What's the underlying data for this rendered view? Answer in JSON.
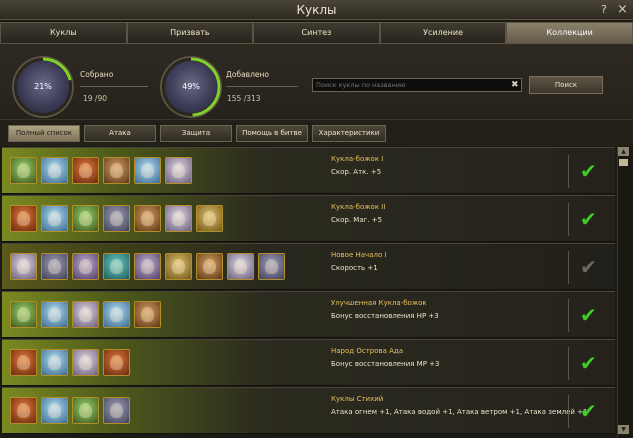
{
  "window": {
    "title": "Куклы",
    "help": "?",
    "close": "×"
  },
  "tabs": [
    {
      "label": "Куклы",
      "active": false
    },
    {
      "label": "Призвать",
      "active": false
    },
    {
      "label": "Синтез",
      "active": false
    },
    {
      "label": "Усиление",
      "active": false
    },
    {
      "label": "Коллекции",
      "active": true
    }
  ],
  "summary": {
    "collected": {
      "percent_text": "21%",
      "label": "Собрано",
      "value": "19 /90",
      "fraction": 0.21
    },
    "added": {
      "percent_text": "49%",
      "label": "Добавлено",
      "value": "155 /313",
      "fraction": 0.49
    }
  },
  "search": {
    "placeholder": "Поиск куклы по названию",
    "clear_icon": "clear-icon",
    "button_label": "Поиск"
  },
  "filters": [
    {
      "label": "Полный список",
      "active": true
    },
    {
      "label": "Атака",
      "active": false
    },
    {
      "label": "Защита",
      "active": false
    },
    {
      "label": "Помощь в битве",
      "active": false
    },
    {
      "label": "Характеристики",
      "active": false
    }
  ],
  "collections": [
    {
      "name": "Кукла-божок I",
      "bonus": "Скор. Атк. +5",
      "complete": true,
      "dolls": [
        "c1",
        "c2",
        "c3",
        "c5",
        "c2",
        "c4"
      ]
    },
    {
      "name": "Кукла-божок II",
      "bonus": "Скор. Маг. +5",
      "complete": true,
      "dolls": [
        "c3",
        "c2",
        "c1",
        "c6",
        "c5",
        "c4",
        "c8"
      ]
    },
    {
      "name": "Новое Начало I",
      "bonus": "Скорость +1",
      "complete": false,
      "dolls": [
        "c4",
        "c6",
        "c9",
        "c7",
        "c9",
        "c8",
        "c5",
        "c4",
        "c6"
      ]
    },
    {
      "name": "Улучшенная Кукла-божок",
      "bonus": "Бонус восстановления HP +3",
      "complete": true,
      "dolls": [
        "c1",
        "c2",
        "c4",
        "c2",
        "c5"
      ]
    },
    {
      "name": "Народ Острова Ада",
      "bonus": "Бонус восстановления MP +3",
      "complete": true,
      "dolls": [
        "c3",
        "c2",
        "c4",
        "c3"
      ]
    },
    {
      "name": "Куклы Стихий",
      "bonus": "Атака огнем +1, Атака водой +1, Атака ветром +1, Атака землей +1",
      "complete": true,
      "dolls": [
        "c3",
        "c2",
        "c1",
        "c6"
      ]
    }
  ],
  "scrollbar": {
    "up_icon": "arrow-up-icon",
    "down_icon": "arrow-down-icon"
  }
}
